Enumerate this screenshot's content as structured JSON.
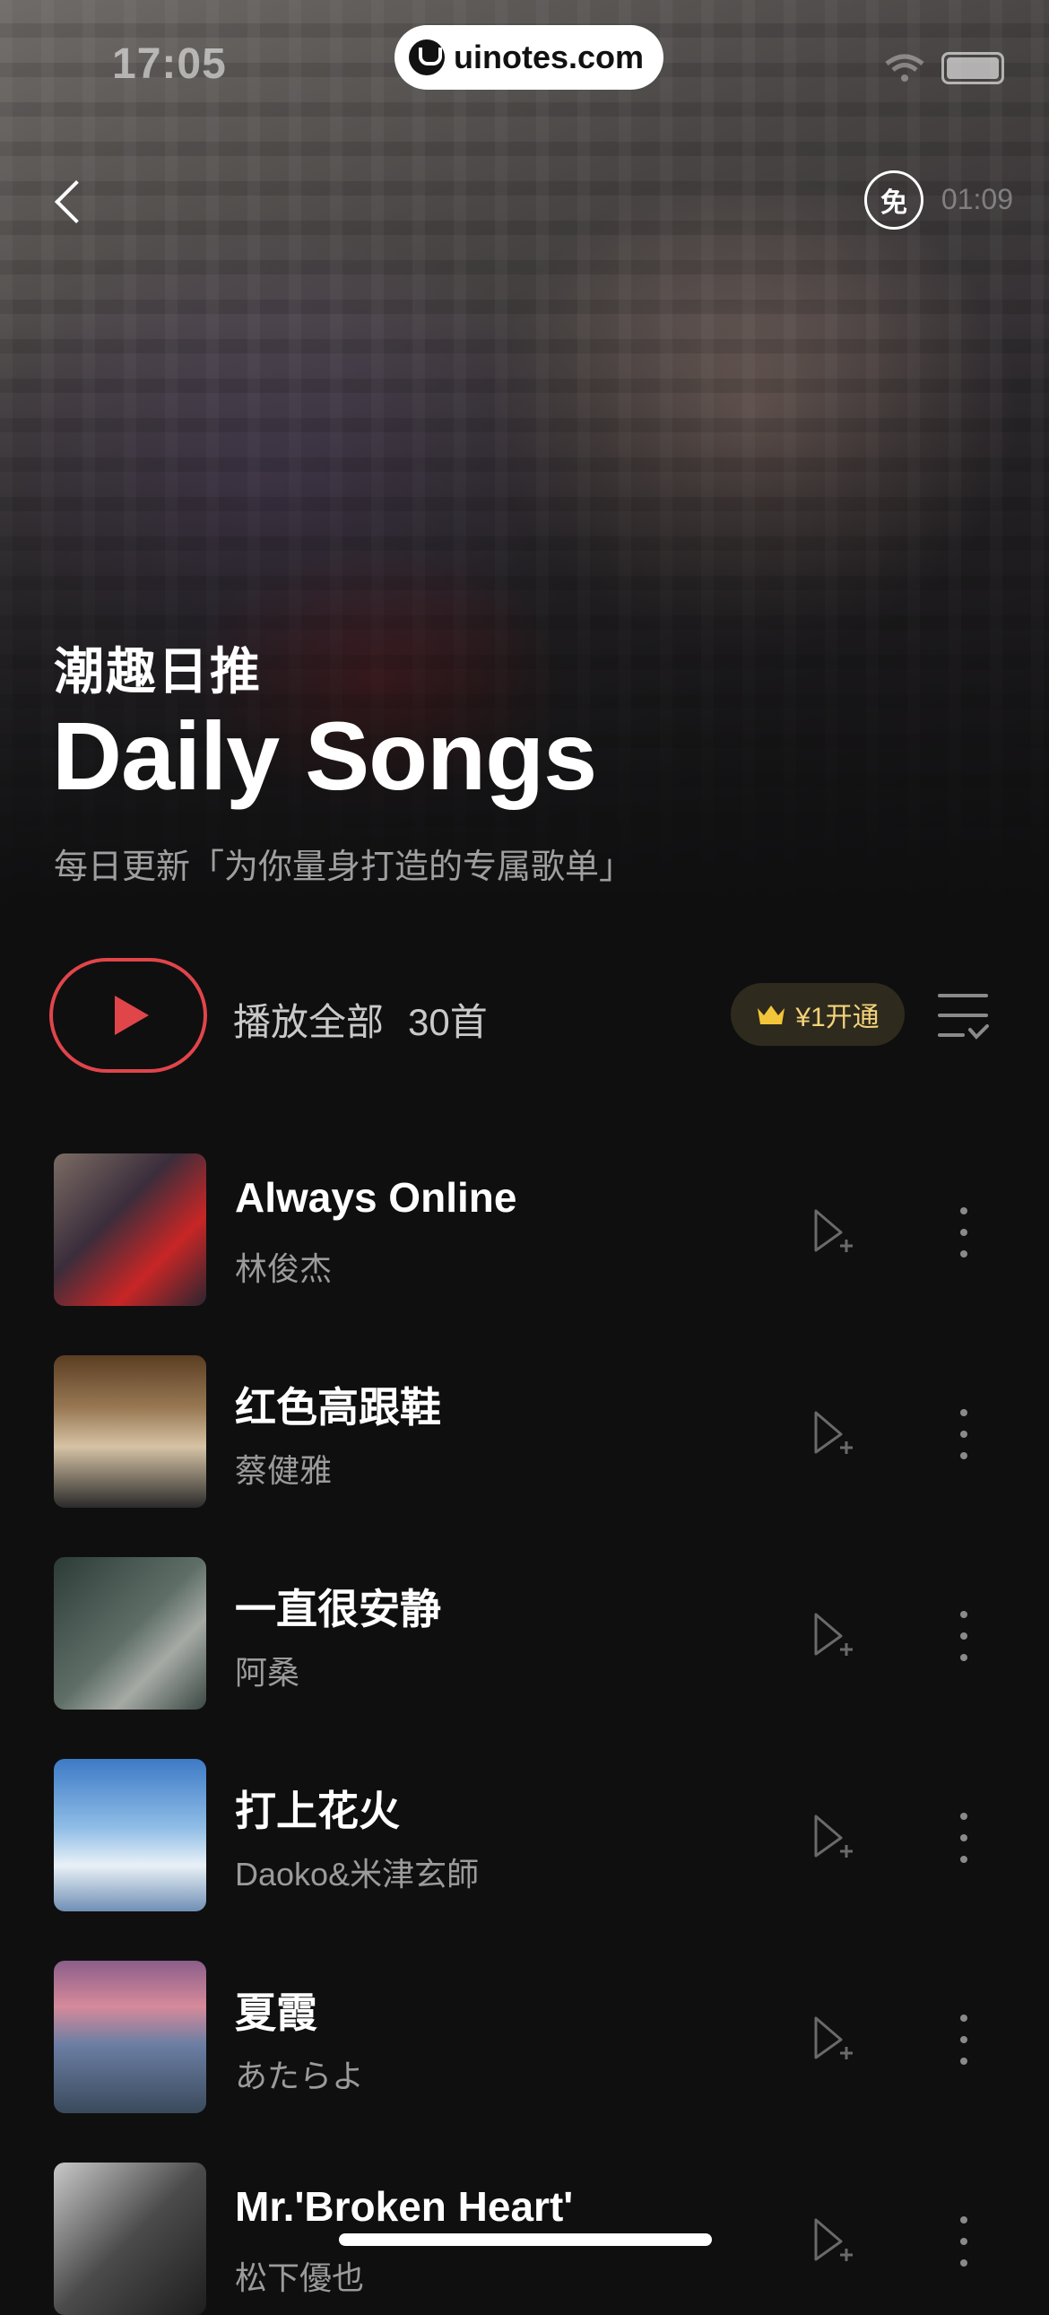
{
  "status_bar": {
    "time": "17:05",
    "watermark": "uinotes.com"
  },
  "nav": {
    "free_label": "免",
    "free_time": "01:09"
  },
  "hero": {
    "title_cn": "潮趣日推",
    "title_en": "Daily Songs",
    "subtitle": "每日更新「为你量身打造的专属歌单」"
  },
  "play_bar": {
    "play_all_label": "播放全部",
    "count": "30首",
    "vip_label": "¥1开通"
  },
  "songs": [
    {
      "title": "Always Online",
      "artist": "林俊杰"
    },
    {
      "title": "红色高跟鞋",
      "artist": "蔡健雅"
    },
    {
      "title": "一直很安静",
      "artist": "阿桑"
    },
    {
      "title": "打上花火",
      "artist": "Daoko&米津玄師"
    },
    {
      "title": "夏霞",
      "artist": "あたらよ"
    },
    {
      "title": "Mr.'Broken Heart'",
      "artist": "松下優也"
    }
  ],
  "colors": {
    "accent_red": "#e0454a",
    "vip_gold": "#f3d27a",
    "background": "#0f0f10"
  },
  "icons": [
    "back-icon",
    "free-icon",
    "play-icon",
    "crown-icon",
    "sort-icon",
    "add-to-playlist-icon",
    "more-icon",
    "wifi-icon",
    "battery-icon"
  ]
}
